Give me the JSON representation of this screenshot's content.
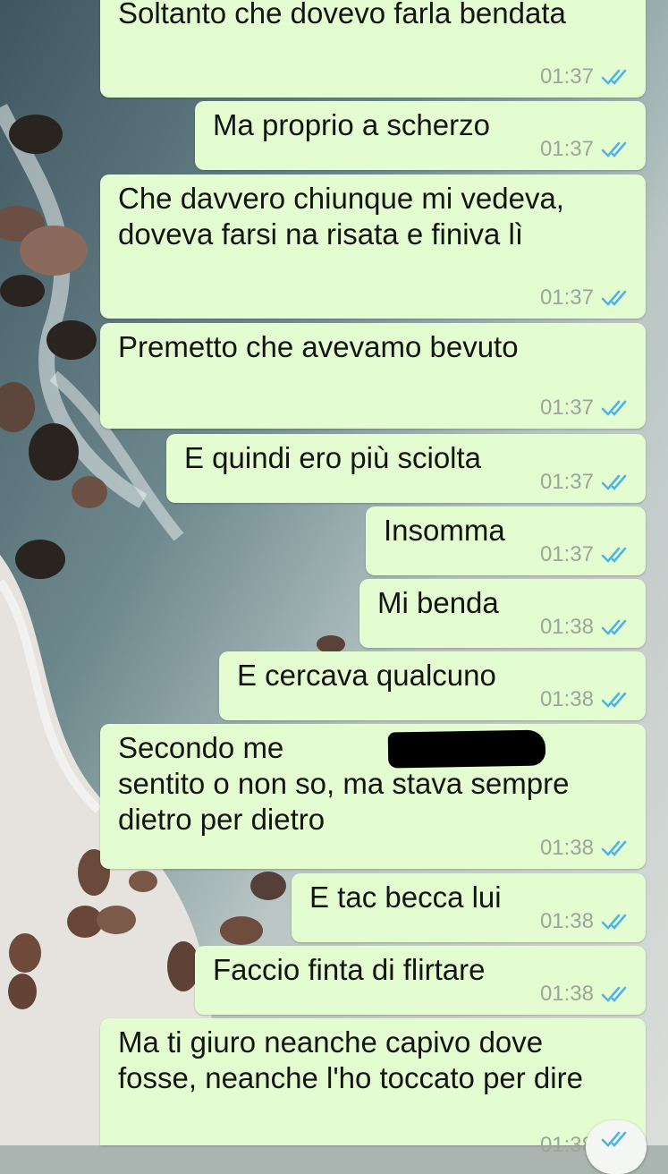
{
  "chat": {
    "time_color": "#9da59a",
    "tick_color": "#4fb3e6",
    "bubble_color": "#e3fdd1",
    "messages": [
      {
        "text": "Soltanto che dovevo farla bendata",
        "time": "01:37",
        "status": "read"
      },
      {
        "text": "Ma proprio a scherzo",
        "time": "01:37",
        "status": "read"
      },
      {
        "text": "Che davvero chiunque mi vedeva,\ndoveva farsi na risata e finiva lì",
        "time": "01:37",
        "status": "read"
      },
      {
        "text": "Premetto che avevamo bevuto",
        "time": "01:37",
        "status": "read"
      },
      {
        "text": "E quindi ero più sciolta",
        "time": "01:37",
        "status": "read"
      },
      {
        "text": "Insomma",
        "time": "01:37",
        "status": "read"
      },
      {
        "text": "Mi benda",
        "time": "01:38",
        "status": "read"
      },
      {
        "text": "E cercava qualcuno",
        "time": "01:38",
        "status": "read"
      },
      {
        "text": "Secondo me              o aveva\nsentito o non so, ma stava sempre\ndietro per dietro",
        "time": "01:38",
        "status": "read"
      },
      {
        "text": "E tac becca lui",
        "time": "01:38",
        "status": "read"
      },
      {
        "text": "Faccio finta di flirtare",
        "time": "01:38",
        "status": "read"
      },
      {
        "text": "Ma ti giuro neanche capivo dove\nfosse, neanche l'ho toccato per dire",
        "time": "01:38",
        "status": "read"
      }
    ]
  },
  "scroll_button_icon": "double-check-icon"
}
